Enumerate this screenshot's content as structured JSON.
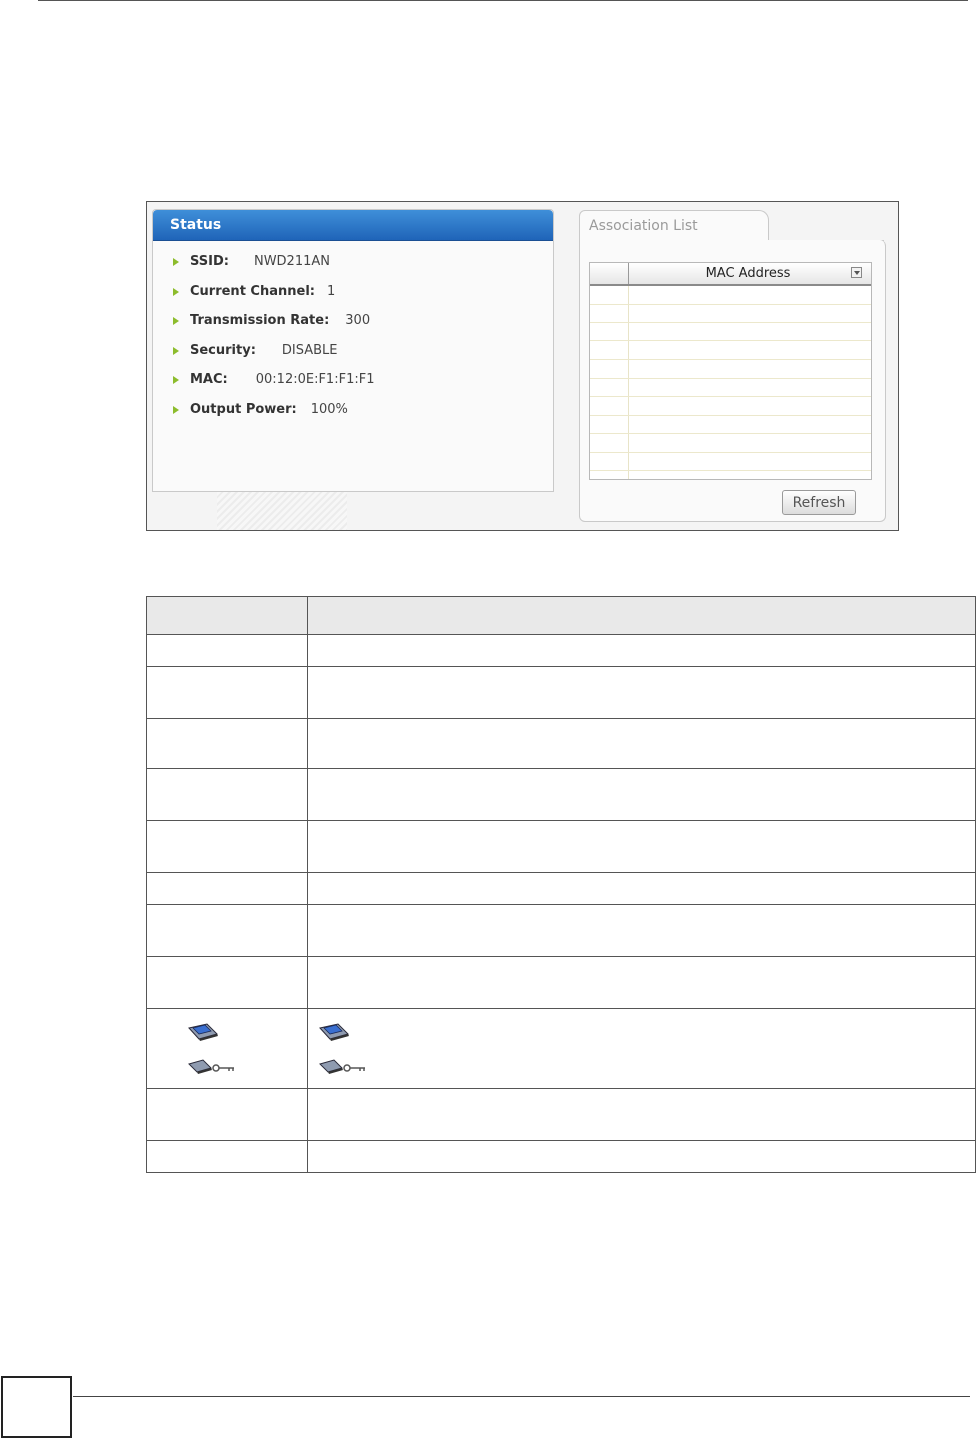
{
  "status_panel": {
    "title": "Status",
    "rows": [
      {
        "label": "SSID:",
        "value": "NWD211AN"
      },
      {
        "label": "Current Channel:",
        "value": "1"
      },
      {
        "label": "Transmission Rate:",
        "value": "300"
      },
      {
        "label": "Security:",
        "value": "DISABLE"
      },
      {
        "label": "MAC:",
        "value": "00:12:0E:F1:F1:F1"
      },
      {
        "label": "Output Power:",
        "value": "100%"
      }
    ]
  },
  "association_list": {
    "tab_label": "Association List",
    "column_header": "MAC Address",
    "refresh_label": "Refresh"
  },
  "reference_table": {
    "row_count": 11,
    "icon_row_index": 8
  },
  "colors": {
    "status_header": "#2a74c9",
    "bullet": "#8cbc2c"
  }
}
